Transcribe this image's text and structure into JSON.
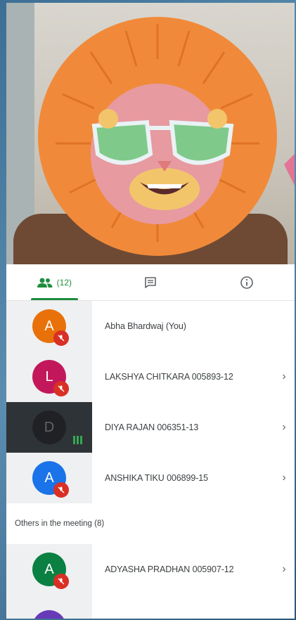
{
  "tabs": {
    "people_count": "(12)",
    "people_color": "#1e8e3e"
  },
  "participants": [
    {
      "initial": "A",
      "name": "Abha Bhardwaj (You)",
      "color": "#e8710a",
      "muted": true,
      "chevron": false
    },
    {
      "initial": "L",
      "name": "LAKSHYA CHITKARA 005893-12",
      "color": "#c2185b",
      "muted": true,
      "chevron": true
    },
    {
      "initial": "D",
      "name": "DIYA RAJAN 006351-13",
      "color": "#202124",
      "muted": false,
      "chevron": true
    },
    {
      "initial": "A",
      "name": "ANSHIKA TIKU 006899-15",
      "color": "#1a73e8",
      "muted": true,
      "chevron": true
    }
  ],
  "others": {
    "heading": "Others in the meeting (8)",
    "items": [
      {
        "initial": "A",
        "name": "ADYASHA PRADHAN 005907-12",
        "color": "#0b8043",
        "muted": true,
        "chevron": true
      }
    ]
  },
  "chevron_glyph": "›"
}
